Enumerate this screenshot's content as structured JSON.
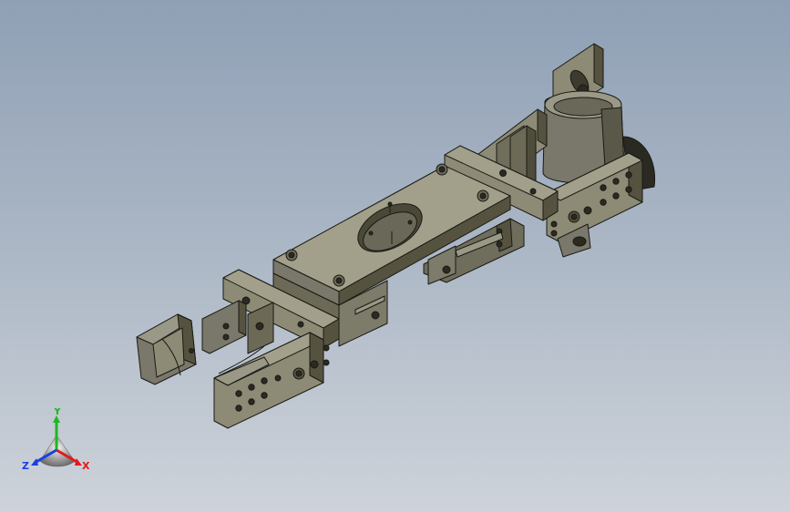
{
  "viewport": {
    "background_top": "#8fa0b5",
    "background_bottom": "#ced3da"
  },
  "model": {
    "body_color": "#76745f",
    "face_light": "#8d8b76",
    "face_dark": "#55533f",
    "edge_color": "#1a1a14"
  },
  "triad": {
    "x_label": "X",
    "y_label": "Y",
    "z_label": "Z",
    "x_color": "#e01b1b",
    "y_color": "#1fb81f",
    "z_color": "#1b3fe0"
  }
}
